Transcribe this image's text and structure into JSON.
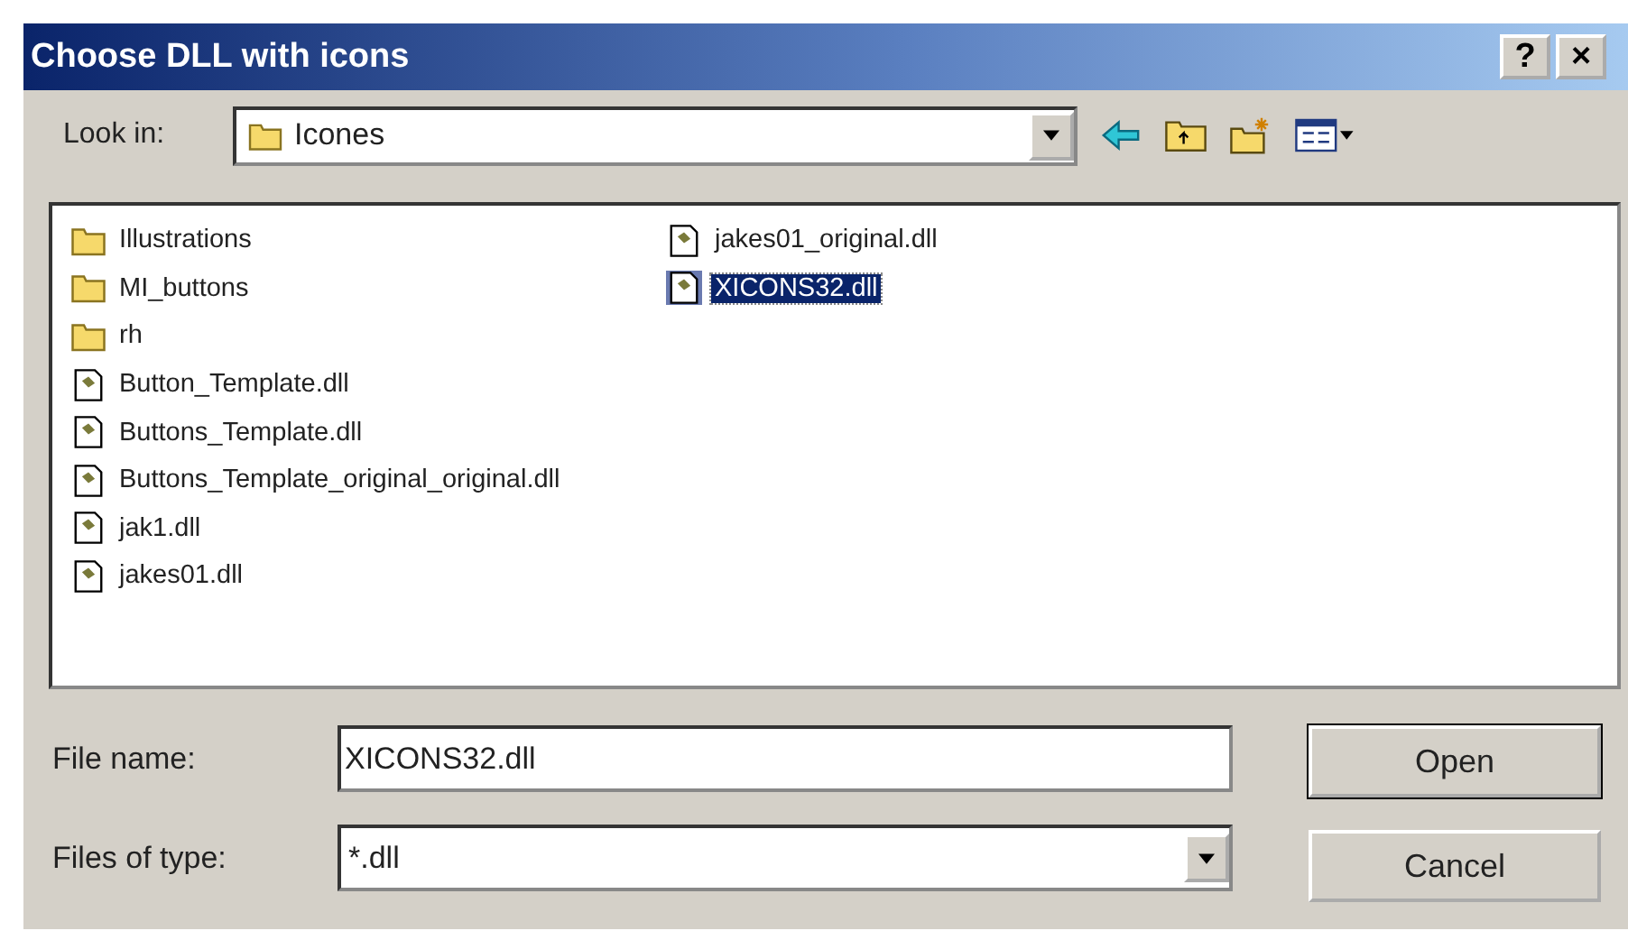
{
  "window": {
    "title": "Choose DLL with icons",
    "help_button": "?",
    "close_button": "×"
  },
  "look_in": {
    "label": "Look in:",
    "value": "Icones"
  },
  "files": [
    {
      "name": "Illustrations",
      "kind": "folder",
      "selected": false
    },
    {
      "name": "MI_buttons",
      "kind": "folder",
      "selected": false
    },
    {
      "name": "rh",
      "kind": "folder",
      "selected": false
    },
    {
      "name": "Button_Template.dll",
      "kind": "dll",
      "selected": false
    },
    {
      "name": "Buttons_Template.dll",
      "kind": "dll",
      "selected": false
    },
    {
      "name": "Buttons_Template_original_original.dll",
      "kind": "dll",
      "selected": false
    },
    {
      "name": "jak1.dll",
      "kind": "dll",
      "selected": false
    },
    {
      "name": "jakes01.dll",
      "kind": "dll",
      "selected": false
    },
    {
      "name": "jakes01_original.dll",
      "kind": "dll",
      "selected": false
    },
    {
      "name": "XICONS32.dll",
      "kind": "dll",
      "selected": true
    }
  ],
  "file_name": {
    "label": "File name:",
    "value": "XICONS32.dll"
  },
  "file_type": {
    "label": "Files of type:",
    "value": "*.dll"
  },
  "buttons": [
    {
      "label": "Open",
      "kind": "default"
    },
    {
      "label": "Cancel",
      "kind": "normal"
    }
  ]
}
